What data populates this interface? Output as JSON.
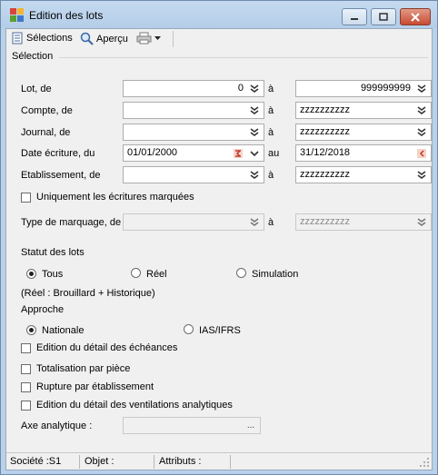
{
  "window": {
    "title": "Edition des lots"
  },
  "toolbar": {
    "selections_label": "Sélections",
    "apercu_label": "Aperçu"
  },
  "section": {
    "title": "Sélection"
  },
  "rows": {
    "lot": {
      "label": "Lot, de",
      "from": "0",
      "sep": "à",
      "to": "999999999"
    },
    "compte": {
      "label": "Compte, de",
      "from": "",
      "sep": "à",
      "to": "zzzzzzzzzz"
    },
    "journal": {
      "label": "Journal, de",
      "from": "",
      "sep": "à",
      "to": "zzzzzzzzzz"
    },
    "date": {
      "label": "Date écriture, du",
      "from": "01/01/2000",
      "sep": "au",
      "to": "31/12/2018"
    },
    "etab": {
      "label": "Etablissement, de",
      "from": "",
      "sep": "à",
      "to": "zzzzzzzzzz"
    },
    "marquage": {
      "label": "Type de marquage, de",
      "from": "",
      "sep": "à",
      "to": "zzzzzzzzzz"
    }
  },
  "checks": {
    "uniquement": "Uniquement les écritures marquées",
    "detail_echeances": "Edition du détail des échéances",
    "totalisation": "Totalisation par pièce",
    "rupture": "Rupture par établissement",
    "detail_ventilations": "Edition du détail des ventilations analytiques"
  },
  "statut": {
    "title": "Statut des lots",
    "opt_tous": "Tous",
    "opt_reel": "Réel",
    "opt_simulation": "Simulation",
    "note": "(Réel : Brouillard + Historique)",
    "selected": "Tous"
  },
  "approche": {
    "title": "Approche",
    "opt_nationale": "Nationale",
    "opt_ias": "IAS/IFRS",
    "selected": "Nationale"
  },
  "axe": {
    "label": "Axe analytique :",
    "value": "",
    "browse": "..."
  },
  "status": {
    "societe": "Société :S1",
    "objet": "Objet :",
    "attributs": "Attributs :"
  }
}
